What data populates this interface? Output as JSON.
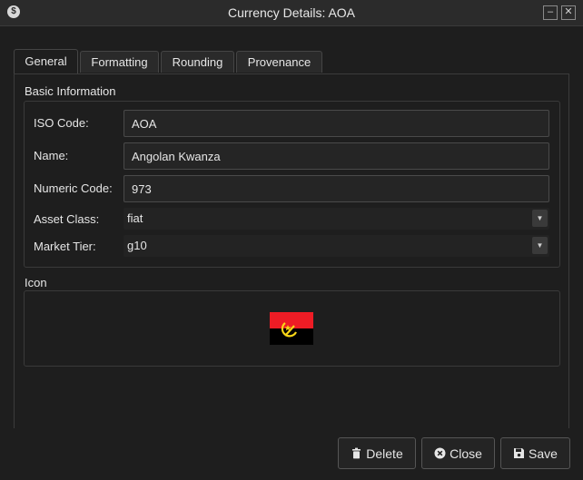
{
  "window": {
    "title": "Currency Details: AOA",
    "app_icon_glyph": "$",
    "minimize_glyph": "–",
    "close_glyph": "✕"
  },
  "tabs": [
    {
      "label": "General",
      "active": true
    },
    {
      "label": "Formatting",
      "active": false
    },
    {
      "label": "Rounding",
      "active": false
    },
    {
      "label": "Provenance",
      "active": false
    }
  ],
  "basic_info": {
    "section_label": "Basic Information",
    "iso_code": {
      "label": "ISO Code:",
      "value": "AOA"
    },
    "name": {
      "label": "Name:",
      "value": "Angolan Kwanza"
    },
    "numeric_code": {
      "label": "Numeric Code:",
      "value": "973"
    },
    "asset_class": {
      "label": "Asset Class:",
      "value": "fiat"
    },
    "market_tier": {
      "label": "Market Tier:",
      "value": "g10"
    }
  },
  "icon_section": {
    "section_label": "Icon",
    "flag_icon": "angola-flag-icon",
    "flag_colors": {
      "top": "#ee1c25",
      "bottom": "#000000",
      "emblem": "#f9d616"
    }
  },
  "buttons": {
    "delete_label": "Delete",
    "close_label": "Close",
    "save_label": "Save"
  },
  "colors": {
    "background": "#1e1e1e",
    "titlebar": "#2b2b2b",
    "input_border": "#4a4a4a",
    "text": "#e6e6e6"
  }
}
